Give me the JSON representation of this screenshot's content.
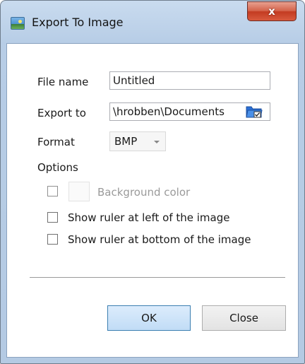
{
  "window": {
    "title": "Export To Image",
    "close_glyph": "x"
  },
  "form": {
    "file_name_label": "File name",
    "file_name_value": "Untitled",
    "export_to_label": "Export to",
    "export_to_value": "\\hrobben\\Documents",
    "format_label": "Format",
    "format_value": "BMP",
    "options_label": "Options"
  },
  "options": {
    "background_color_label": "Background color",
    "background_color_checked": false,
    "ruler_left_label": "Show ruler at left of the image",
    "ruler_left_checked": false,
    "ruler_bottom_label": "Show ruler at bottom of the image",
    "ruler_bottom_checked": false
  },
  "buttons": {
    "ok_label": "OK",
    "close_label": "Close"
  },
  "icons": {
    "app": "image-icon",
    "browse": "folder-browse-icon"
  },
  "colors": {
    "frame": "#b7cde6",
    "close_button": "#c33b21",
    "ok_button": "#c1dcf6"
  }
}
